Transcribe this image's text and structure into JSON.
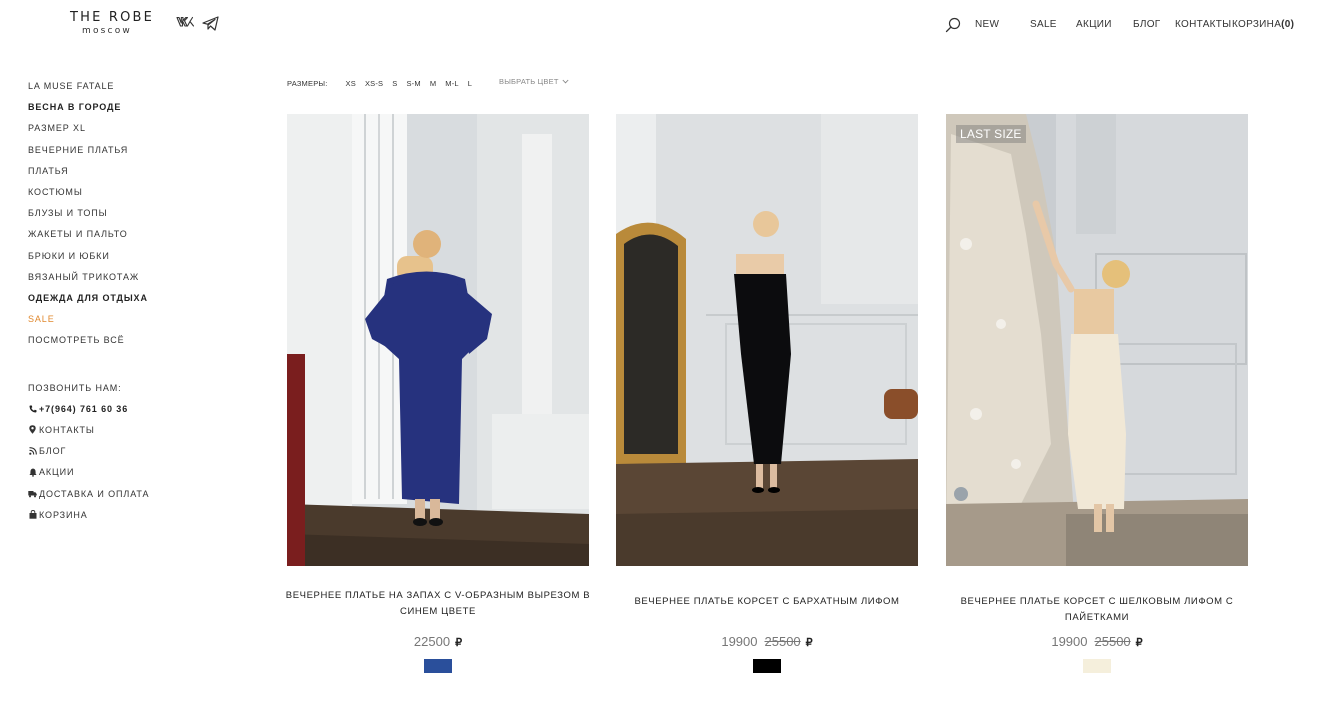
{
  "header": {
    "logo_top": "THE ROBE",
    "logo_bottom": "moscow",
    "nav": [
      "NEW",
      "SALE",
      "АКЦИИ",
      "БЛОГ",
      "КОНТАКТЫ"
    ],
    "cart_label": "КОРЗИНА",
    "cart_count": "(0)"
  },
  "sidebar": {
    "categories": [
      {
        "label": "LA MUSE FATALE",
        "style": "normal"
      },
      {
        "label": "ВЕСНА В ГОРОДЕ",
        "style": "bold"
      },
      {
        "label": "РАЗМЕР XL",
        "style": "normal"
      },
      {
        "label": "ВЕЧЕРНИЕ ПЛАТЬЯ",
        "style": "normal"
      },
      {
        "label": "ПЛАТЬЯ",
        "style": "normal"
      },
      {
        "label": "КОСТЮМЫ",
        "style": "normal"
      },
      {
        "label": "БЛУЗЫ И ТОПЫ",
        "style": "normal"
      },
      {
        "label": "ЖАКЕТЫ И ПАЛЬТО",
        "style": "normal"
      },
      {
        "label": "БРЮКИ И ЮБКИ",
        "style": "normal"
      },
      {
        "label": "ВЯЗАНЫЙ ТРИКОТАЖ",
        "style": "normal"
      },
      {
        "label": "ОДЕЖДА ДЛЯ ОТДЫХА",
        "style": "bold"
      },
      {
        "label": "SALE",
        "style": "sale"
      },
      {
        "label": "ПОСМОТРЕТЬ ВСЁ",
        "style": "normal"
      }
    ],
    "call_label": "ПОЗВОНИТЬ НАМ:",
    "phone": "+7(964) 761 60 36",
    "contacts": "КОНТАКТЫ",
    "blog": "БЛОГ",
    "promos": "АКЦИИ",
    "delivery": "ДОСТАВКА И ОПЛАТА",
    "cart": "КОРЗИНА"
  },
  "filters": {
    "sizes_label": "РАЗМЕРЫ:",
    "sizes": [
      "XS",
      "XS-S",
      "S",
      "S-M",
      "M",
      "M-L",
      "L"
    ],
    "color_label": "ВЫБРАТЬ ЦВЕТ"
  },
  "products": [
    {
      "name": "ВЕЧЕРНЕЕ ПЛАТЬЕ НА ЗАПАХ С V-ОБРАЗНЫМ ВЫРЕЗОМ В СИНЕМ ЦВЕТЕ",
      "price": "22500",
      "old_price": "",
      "currency": "₽",
      "swatch": "#2a4f9b",
      "badge": ""
    },
    {
      "name": "ВЕЧЕРНЕЕ ПЛАТЬЕ КОРСЕТ С БАРХАТНЫМ ЛИФОМ",
      "price": "19900",
      "old_price": "25500",
      "currency": "₽",
      "swatch": "#000000",
      "badge": ""
    },
    {
      "name": "ВЕЧЕРНЕЕ ПЛАТЬЕ КОРСЕТ С ШЕЛКОВЫМ ЛИФОМ С ПАЙЕТКАМИ",
      "price": "19900",
      "old_price": "25500",
      "currency": "₽",
      "swatch": "#f5efdc",
      "badge": "LAST SIZE"
    }
  ],
  "colors": {
    "sale": "#e0882e",
    "text": "#222222",
    "muted": "#777777"
  }
}
